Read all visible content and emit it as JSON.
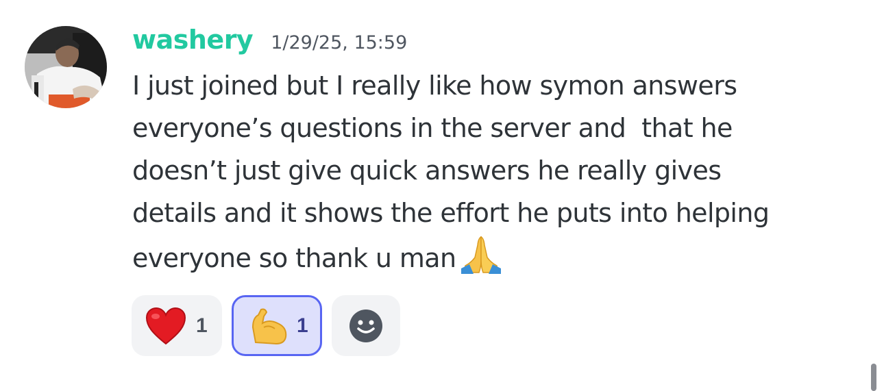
{
  "message": {
    "author": "washery",
    "timestamp": "1/29/25, 15:59",
    "body": "I just joined but I really like how symon answers\neveryone’s questions in the server and  that he\ndoesn’t just give quick answers he really gives\ndetails and it shows the effort he puts into helping\neveryone so thank u man",
    "inline_emoji": "folded-hands-icon",
    "username_color": "#22c9a0"
  },
  "reactions": [
    {
      "emoji": "red-heart-icon",
      "count": "1",
      "selected": false
    },
    {
      "emoji": "flexed-biceps-icon",
      "count": "1",
      "selected": true
    }
  ],
  "add_reaction": {
    "icon": "smiley-face-icon"
  },
  "colors": {
    "accent": "#5865f2",
    "selected_bg": "#dee0fc",
    "reaction_bg": "#f2f3f5",
    "text": "#2e3338"
  }
}
